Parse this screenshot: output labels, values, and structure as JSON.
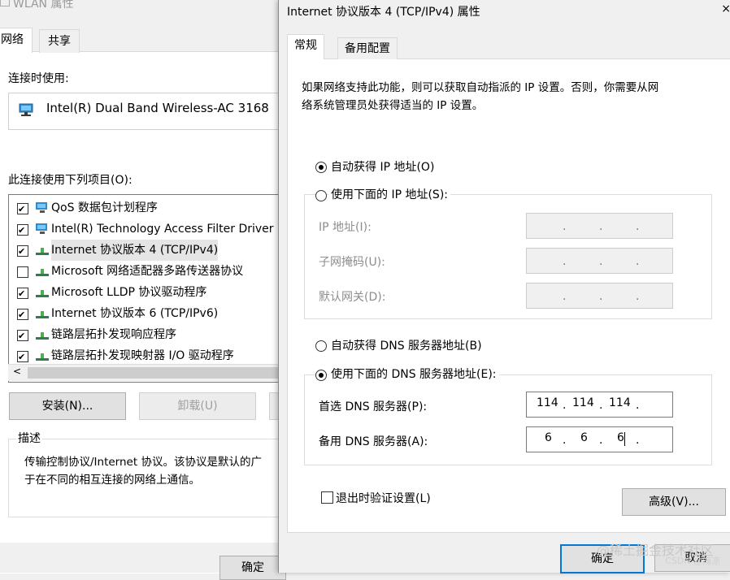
{
  "back_window": {
    "title": "WLAN 属性",
    "tabs": [
      {
        "label": "网络"
      },
      {
        "label": "共享"
      }
    ],
    "connect_using_label": "连接时使用:",
    "adapter_name": "Intel(R) Dual Band Wireless-AC 3168",
    "items_label": "此连接使用下列项目(O):",
    "items": [
      {
        "label": "QoS 数据包计划程序",
        "checked": true
      },
      {
        "label": "Intel(R) Technology Access Filter Driver",
        "checked": true
      },
      {
        "label": "Internet 协议版本 4 (TCP/IPv4)",
        "checked": true
      },
      {
        "label": "Microsoft 网络适配器多路传送器协议",
        "checked": false
      },
      {
        "label": "Microsoft LLDP 协议驱动程序",
        "checked": true
      },
      {
        "label": "Internet 协议版本 6 (TCP/IPv6)",
        "checked": true
      },
      {
        "label": "链路层拓扑发现响应程序",
        "checked": true
      },
      {
        "label": "链路层拓扑发现映射器 I/O 驱动程序",
        "checked": true
      }
    ],
    "scroll_left_glyph": "<",
    "install_label": "安装(N)...",
    "uninstall_label": "卸载(U)",
    "description_title": "描述",
    "description_line1": "传输控制协议/Internet 协议。该协议是默认的广",
    "description_line2": "于在不同的相互连接的网络上通信。",
    "ok_label": "确定"
  },
  "front_window": {
    "title": "Internet 协议版本 4 (TCP/IPv4) 属性",
    "close_glyph": "×",
    "tabs": [
      {
        "label": "常规"
      },
      {
        "label": "备用配置"
      }
    ],
    "intro_line1": "如果网络支持此功能，则可以获取自动指派的 IP 设置。否则，你需要从网",
    "intro_line2": "络系统管理员处获得适当的 IP 设置。",
    "ip_auto_label": "自动获得 IP 地址(O)",
    "ip_manual_label": "使用下面的 IP 地址(S):",
    "ip_address_label": "IP 地址(I):",
    "subnet_label": "子网掩码(U):",
    "gateway_label": "默认网关(D):",
    "dns_auto_label": "自动获得 DNS 服务器地址(B)",
    "dns_manual_label": "使用下面的 DNS 服务器地址(E):",
    "preferred_dns_label": "首选 DNS 服务器(P):",
    "preferred_dns": [
      "114",
      "114",
      "114",
      ""
    ],
    "alternate_dns_label": "备用 DNS 服务器(A):",
    "alternate_dns": [
      "6",
      "6",
      "6",
      ""
    ],
    "validate_label": "退出时验证设置(L)",
    "advanced_label": "高级(V)...",
    "ok_label": "确定",
    "cancel_label": "取消"
  },
  "watermark": {
    "text": "@稀土掘金技术社区",
    "sub": "CSDN @海凉"
  },
  "colors": {
    "accent": "#0078d7",
    "window_bg": "#f0f0f0",
    "page_bg": "#ffffff"
  }
}
